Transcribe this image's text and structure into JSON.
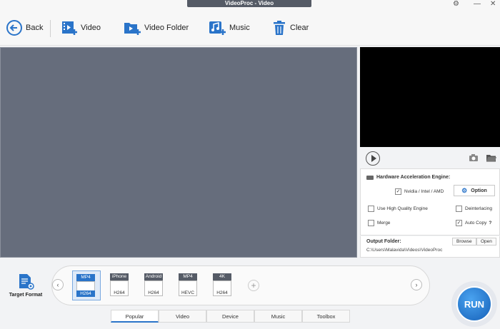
{
  "window": {
    "title": "VideoProc - Video"
  },
  "toolbar": {
    "back": "Back",
    "video": "Video",
    "video_folder": "Video Folder",
    "music": "Music",
    "clear": "Clear"
  },
  "hardware": {
    "title": "Hardware Acceleration Engine:",
    "nvidia_label": "Nvidia / Intel / AMD",
    "nvidia_checked": true,
    "option_label": "Option"
  },
  "settings": {
    "high_quality": "Use High Quality Engine",
    "deinterlacing": "Deinterlacing",
    "merge": "Merge",
    "auto_copy": "Auto Copy",
    "help": "?"
  },
  "output": {
    "label": "Output Folder:",
    "path": "C:\\Users\\Malavida\\Videos\\VideoProc",
    "browse": "Browse",
    "open": "Open"
  },
  "target_format": "Target Format",
  "formats": [
    {
      "top": "MP4",
      "bottom": "H264",
      "selected": true
    },
    {
      "top": "iPhone",
      "bottom": "H264",
      "selected": false
    },
    {
      "top": "Android",
      "bottom": "H264",
      "selected": false
    },
    {
      "top": "MP4",
      "bottom": "HEVC",
      "selected": false
    },
    {
      "top": "4K",
      "bottom": "H264",
      "selected": false
    }
  ],
  "tabs": [
    "Popular",
    "Video",
    "Device",
    "Music",
    "Toolbox"
  ],
  "run_label": "RUN",
  "colors": {
    "accent": "#2a74c9",
    "file_area": "#666d7c"
  }
}
